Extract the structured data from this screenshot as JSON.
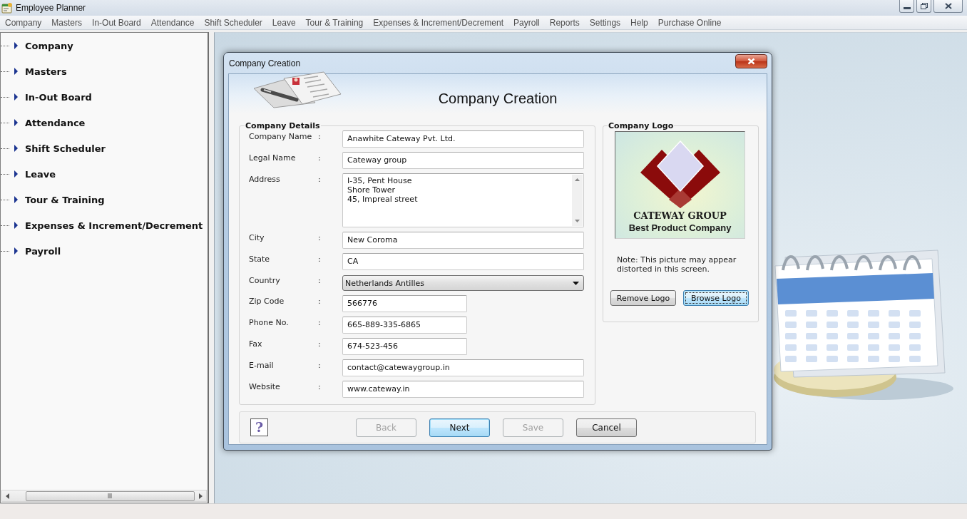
{
  "window": {
    "title": "Employee Planner"
  },
  "menu": [
    "Company",
    "Masters",
    "In-Out Board",
    "Attendance",
    "Shift Scheduler",
    "Leave",
    "Tour & Training",
    "Expenses & Increment/Decrement",
    "Payroll",
    "Reports",
    "Settings",
    "Help",
    "Purchase Online"
  ],
  "sidebar": {
    "items": [
      {
        "label": "Company",
        "expanded": false
      },
      {
        "label": "Masters",
        "expanded": false
      },
      {
        "label": "In-Out Board",
        "expanded": false
      },
      {
        "label": "Attendance",
        "expanded": false
      },
      {
        "label": "Shift Scheduler",
        "expanded": false
      },
      {
        "label": "Leave",
        "expanded": false
      },
      {
        "label": "Tour & Training",
        "expanded": false
      },
      {
        "label": "Expenses & Increment/Decrement",
        "expanded": false
      },
      {
        "label": "Payroll",
        "expanded": false
      }
    ]
  },
  "dialog": {
    "title": "Company Creation",
    "heading": "Company Creation",
    "details": {
      "legend": "Company Details",
      "fields": [
        {
          "label": "Company Name",
          "colon": ":",
          "kind": "text",
          "value": "Anawhite Cateway Pvt. Ltd."
        },
        {
          "label": "Legal Name",
          "colon": ":",
          "kind": "text",
          "value": "Cateway group"
        },
        {
          "label": "Address",
          "colon": ":",
          "kind": "multiline",
          "lines": [
            "I-35, Pent House",
            "Shore Tower",
            "45, Impreal street"
          ]
        },
        {
          "label": "City",
          "colon": ":",
          "kind": "text",
          "value": "New Coroma"
        },
        {
          "label": "State",
          "colon": ":",
          "kind": "text",
          "value": "CA"
        },
        {
          "label": "Country",
          "colon": ":",
          "kind": "select",
          "value": "Netherlands Antilles"
        },
        {
          "label": "Zip Code",
          "colon": ":",
          "kind": "short",
          "value": "566776"
        },
        {
          "label": "Phone No.",
          "colon": ":",
          "kind": "short",
          "value": "665-889-335-6865"
        },
        {
          "label": "Fax",
          "colon": ":",
          "kind": "short",
          "value": "674-523-456"
        },
        {
          "label": "E-mail",
          "colon": ":",
          "kind": "text",
          "value": "contact@catewaygroup.in"
        },
        {
          "label": "Website",
          "colon": ":",
          "kind": "text",
          "value": "www.cateway.in"
        }
      ]
    },
    "logo": {
      "legend": "Company Logo",
      "picture": {
        "name": "CATEWAY GROUP",
        "tagline": "Best Product Company"
      },
      "note": "Note: This picture may appear distorted in this screen.",
      "buttons": [
        {
          "label": "Remove Logo",
          "focused": false
        },
        {
          "label": "Browse Logo",
          "focused": true
        }
      ]
    },
    "help": "?",
    "buttons": [
      {
        "label": "Back",
        "disabled": true,
        "focused": false
      },
      {
        "label": "Next",
        "disabled": false,
        "focused": true
      },
      {
        "label": "Save",
        "disabled": true,
        "focused": false
      },
      {
        "label": "Cancel",
        "disabled": false,
        "focused": false
      }
    ]
  }
}
